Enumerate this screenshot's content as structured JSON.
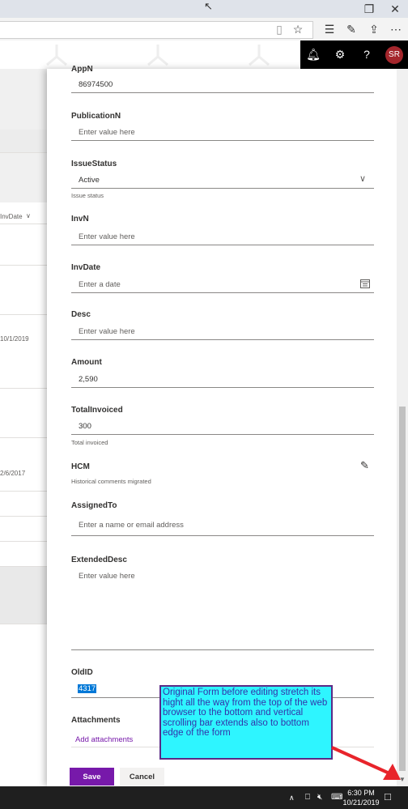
{
  "form": {
    "fields": [
      {
        "label": "AppN",
        "value": "86974500"
      },
      {
        "label": "PublicationN",
        "placeholder": "Enter value here"
      },
      {
        "label": "IssueStatus",
        "value": "Active",
        "description": "Issue status"
      },
      {
        "label": "InvN",
        "placeholder": "Enter value here"
      },
      {
        "label": "InvDate",
        "placeholder": "Enter a date"
      },
      {
        "label": "Desc",
        "placeholder": "Enter value here"
      },
      {
        "label": "Amount",
        "value": "2,590"
      },
      {
        "label": "TotalInvoiced",
        "value": "300",
        "description": "Total invoiced"
      },
      {
        "label": "HCM",
        "description": "Historical comments migrated"
      },
      {
        "label": "AssignedTo",
        "placeholder": "Enter a name or email address"
      },
      {
        "label": "ExtendedDesc",
        "placeholder": "Enter value here"
      },
      {
        "label": "OldID",
        "value": "4317"
      },
      {
        "label": "Attachments",
        "link": "Add attachments"
      }
    ],
    "save_label": "Save",
    "cancel_label": "Cancel"
  },
  "list_bg": {
    "column_header": "InvDate",
    "dates": [
      "10/1/2019",
      "2/6/2017"
    ]
  },
  "header": {
    "avatar_initials": "SR"
  },
  "taskbar": {
    "time": "6:30 PM",
    "date": "10/21/2019"
  },
  "annotation": {
    "text": "Original Form before editing stretch its hight all the way from the top of the web browser to the bottom and vertical scrolling bar extends also to bottom edge of the form"
  },
  "colors": {
    "accent": "#7719aa",
    "annotation_bg": "#2ef5ff",
    "annotation_border": "#5b2a86",
    "arrow": "#e8242b",
    "avatar": "#a4262c"
  },
  "icons": [
    "cursor-icon",
    "restore-icon",
    "close-icon",
    "reading-view-icon",
    "favorite-star-icon",
    "favorites-bar-icon",
    "pen-icon",
    "share-icon",
    "more-icon",
    "bell-icon",
    "gear-icon",
    "help-icon",
    "chevron-down-icon",
    "calendar-icon",
    "edit-pencil-icon",
    "network-icon",
    "volume-muted-icon",
    "notification-icon"
  ]
}
